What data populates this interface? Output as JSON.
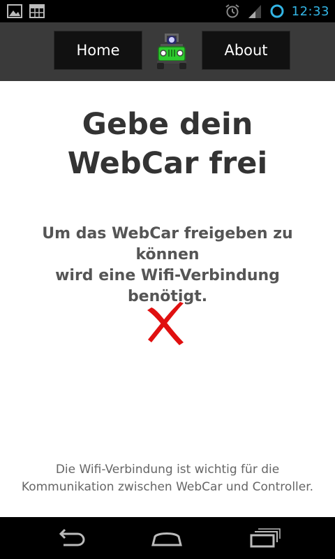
{
  "status_bar": {
    "time": "12:33",
    "icons": [
      "gallery-notification-icon",
      "calendar-notification-icon",
      "alarm-icon",
      "signal-icon",
      "sync-icon"
    ],
    "accent_color": "#33b5e5"
  },
  "header": {
    "home_label": "Home",
    "about_label": "About",
    "logo_icon": "jeep-icon",
    "background_color": "#3a3a3a",
    "button_color": "#111111"
  },
  "main": {
    "title": "Gebe dein\nWebCar frei",
    "subtitle": "Um das WebCar freigeben zu können\nwird eine Wifi-Verbindung benötigt.",
    "status_icon": "red-x-icon",
    "status_color": "#e01010",
    "footer_note": "Die Wifi-Verbindung ist wichtig für die\nKommunikation zwischen WebCar und Controller."
  },
  "nav_bar": {
    "icons": [
      "back-icon",
      "home-icon",
      "recent-apps-icon"
    ]
  }
}
